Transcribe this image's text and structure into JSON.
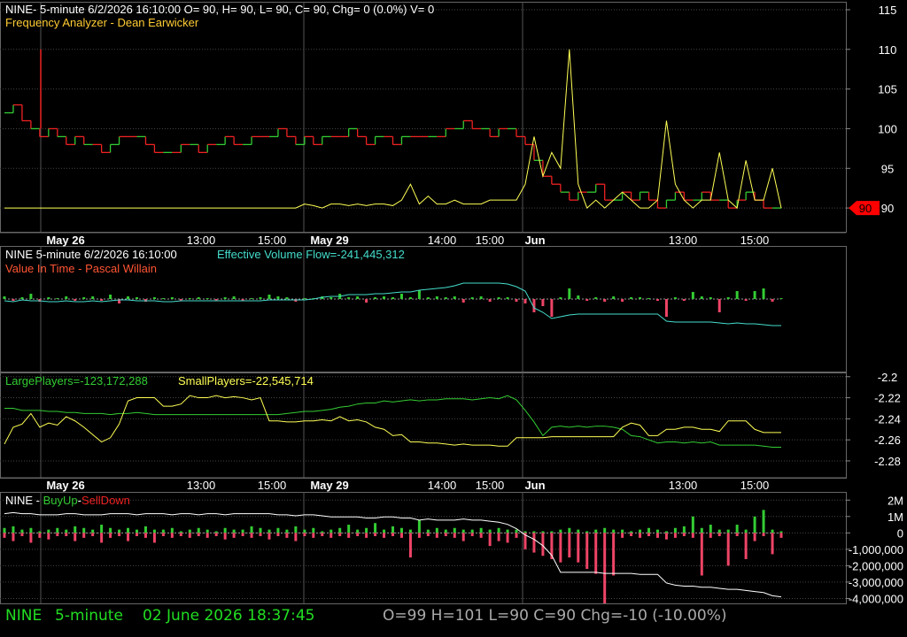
{
  "colors": {
    "bg": "#000000",
    "grid": "#555555",
    "up": "#33cc33",
    "down": "#ee2222",
    "yellow": "#ffff55",
    "cyan": "#44ddcc",
    "green": "#33cc33",
    "white": "#ffffff",
    "orange": "#ffcc33",
    "marker": "#ff0000",
    "axisText": "#ffffff",
    "footGreen": "#22dd22",
    "footGray": "#aaaaaa"
  },
  "panel1": {
    "header": "NINE- 5-minute 6/2/2026 16:10:00 O= 90, H= 90, L= 90, C= 90, Chg= 0 (0.0%) V= 0",
    "subtitle": "Frequency Analyzer - Dean Earwicker",
    "last_price_label": "90"
  },
  "panel2": {
    "header": "NINE 5-minute  6/2/2026 16:10:00",
    "indicator": "Effective Volume Flow=-241,445,312",
    "subtitle": "Value In Time - Pascal Willain"
  },
  "panel3": {
    "large": "LargePlayers=-123,172,288",
    "small": "SmallPlayers=-22,545,714"
  },
  "panel4": {
    "prefix": "NINE - ",
    "buy": "BuyUp",
    "dash": "-",
    "sell": "SellDown"
  },
  "footer": {
    "symbol": "NINE",
    "interval": "5-minute",
    "datetime": "02 June 2026 18:37:45",
    "ohlc": "O=99  H=101  L=90  C=90  Chg=-10 (-10.00%)"
  },
  "chart_data": [
    {
      "type": "line",
      "title": "",
      "y_ticks": [
        90,
        95,
        100,
        105,
        110,
        115
      ],
      "ylim": [
        87,
        116
      ],
      "x_tick_labels": [
        "May 26",
        "13:00",
        "15:00",
        "May 29",
        "14:00",
        "15:00",
        "Jun",
        "13:00",
        "15:00"
      ],
      "series": [
        {
          "name": "",
          "style": "step",
          "values": [
            102,
            103,
            101,
            100,
            99,
            100,
            99,
            98,
            99,
            98,
            98,
            97,
            98,
            99,
            99,
            99,
            98,
            97,
            97,
            97,
            98,
            98,
            97,
            98,
            98,
            99,
            98,
            98,
            99,
            99,
            99,
            100,
            99,
            98,
            99,
            98,
            99,
            99,
            99,
            100,
            99,
            98,
            99,
            99,
            98,
            99,
            99,
            99,
            99,
            99,
            100,
            100,
            101,
            100,
            100,
            99,
            100,
            100,
            99,
            98,
            96,
            94,
            93,
            92,
            91,
            92,
            92,
            93,
            91,
            91,
            92,
            91,
            92,
            91,
            90,
            91,
            92,
            91,
            91,
            92,
            91,
            91,
            90,
            91,
            92,
            91,
            90,
            90,
            90
          ]
        },
        {
          "name": "",
          "style": "line",
          "values": [
            90,
            90,
            90,
            90,
            90,
            90,
            90,
            90,
            90,
            90,
            90,
            90,
            90,
            90,
            90,
            90,
            90,
            90,
            90,
            90,
            90,
            90,
            90,
            90,
            90,
            90,
            90,
            90,
            90,
            90,
            90,
            90,
            90,
            90,
            90.5,
            90.3,
            90,
            90.5,
            90.5,
            90.3,
            90.5,
            90.3,
            90.5,
            90.5,
            90.3,
            91,
            93,
            90.5,
            91.5,
            90.5,
            90.5,
            91,
            90.5,
            90.5,
            90.5,
            91,
            91,
            91,
            91,
            93,
            99,
            94,
            97,
            95,
            110,
            93,
            90,
            91,
            90,
            91,
            92,
            91,
            90,
            90,
            91,
            101,
            93,
            91,
            90,
            91,
            91,
            97,
            91,
            90,
            96,
            91,
            91,
            95,
            90
          ]
        }
      ]
    },
    {
      "type": "bar",
      "title": "",
      "series": [
        {
          "name": "Effective Volume Flow",
          "style": "line",
          "values": [
            -0.2,
            -0.3,
            -0.1,
            -0.2,
            -0.2,
            -0.3,
            -0.3,
            -0.2,
            -0.3,
            -0.3,
            -0.2,
            -0.3,
            -0.2,
            -0.1,
            -0.1,
            -0.2,
            -0.2,
            -0.2,
            -0.3,
            -0.3,
            -0.2,
            -0.2,
            -0.2,
            -0.2,
            -0.2,
            -0.2,
            -0.2,
            -0.2,
            -0.2,
            -0.2,
            -0.1,
            -0.1,
            -0.1,
            -0.1,
            -0.1,
            0,
            0.2,
            0.3,
            0.3,
            0.5,
            0.5,
            0.5,
            0.6,
            0.6,
            0.7,
            0.8,
            0.8,
            1.0,
            1.1,
            1.2,
            1.3,
            1.5,
            1.8,
            1.8,
            1.8,
            1.8,
            1.8,
            1.7,
            1.4,
            0.9,
            -1.0,
            -1.5,
            -2.2,
            -2.0,
            -1.8,
            -1.7,
            -1.7,
            -1.7,
            -1.7,
            -1.7,
            -1.7,
            -1.7,
            -1.7,
            -1.7,
            -1.7,
            -2.5,
            -2.6,
            -2.6,
            -2.6,
            -2.6,
            -2.6,
            -2.7,
            -2.8,
            -2.7,
            -2.8,
            -2.8,
            -2.9,
            -3.0,
            -3.0
          ]
        },
        {
          "name": "",
          "style": "bars",
          "values": [
            0.3,
            -0.2,
            0.2,
            0.6,
            -0.3,
            0.2,
            0.1,
            0.3,
            -0.2,
            0.2,
            0.3,
            -0.2,
            0.5,
            -0.5,
            0.3,
            0.2,
            -0.3,
            0.2,
            0.1,
            0.2,
            -0.2,
            0.1,
            0.2,
            0.1,
            -0.2,
            0.2,
            0.3,
            -0.2,
            0.1,
            0.2,
            0.5,
            0.3,
            0.2,
            -0.3,
            0.1,
            0.1,
            0.3,
            0.2,
            0.6,
            0.2,
            0.3,
            -0.4,
            0.2,
            0.3,
            0.2,
            0.6,
            0.2,
            1.0,
            0.2,
            0.3,
            0.2,
            0.3,
            -0.4,
            0.2,
            0.3,
            -0.3,
            0.2,
            0.2,
            -0.3,
            -0.5,
            -1.5,
            -0.8,
            -2.0,
            0.2,
            1.2,
            0.4,
            -0.2,
            0.2,
            -0.3,
            0.3,
            -0.3,
            0.2,
            0.2,
            0.1,
            -0.2,
            -2.0,
            0.2,
            -0.2,
            0.8,
            0.3,
            0.2,
            -1.5,
            0.2,
            0.9,
            -0.2,
            0.9,
            1.2,
            -0.3,
            0.1
          ]
        }
      ]
    },
    {
      "type": "line",
      "title": "",
      "y_ticks": [
        -2.2,
        -2.22,
        -2.24,
        -2.26,
        -2.28
      ],
      "ylim": [
        -2.296,
        -2.196
      ],
      "series": [
        {
          "name": "LargePlayers",
          "values": [
            -2.23,
            -2.23,
            -2.232,
            -2.232,
            -2.232,
            -2.233,
            -2.233,
            -2.234,
            -2.234,
            -2.235,
            -2.235,
            -2.235,
            -2.236,
            -2.235,
            -2.235,
            -2.234,
            -2.235,
            -2.236,
            -2.236,
            -2.236,
            -2.236,
            -2.236,
            -2.236,
            -2.236,
            -2.236,
            -2.236,
            -2.236,
            -2.236,
            -2.236,
            -2.236,
            -2.236,
            -2.236,
            -2.235,
            -2.234,
            -2.233,
            -2.233,
            -2.232,
            -2.231,
            -2.229,
            -2.228,
            -2.226,
            -2.225,
            -2.225,
            -2.223,
            -2.224,
            -2.223,
            -2.222,
            -2.223,
            -2.222,
            -2.222,
            -2.221,
            -2.221,
            -2.221,
            -2.222,
            -2.221,
            -2.22,
            -2.221,
            -2.218,
            -2.222,
            -2.232,
            -2.243,
            -2.256,
            -2.248,
            -2.247,
            -2.248,
            -2.247,
            -2.248,
            -2.247,
            -2.247,
            -2.248,
            -2.25,
            -2.256,
            -2.257,
            -2.26,
            -2.263,
            -2.262,
            -2.262,
            -2.263,
            -2.262,
            -2.263,
            -2.262,
            -2.265,
            -2.265,
            -2.265,
            -2.265,
            -2.265,
            -2.266,
            -2.267,
            -2.267
          ]
        },
        {
          "name": "SmallPlayers",
          "values": [
            -2.264,
            -2.248,
            -2.245,
            -2.235,
            -2.248,
            -2.244,
            -2.246,
            -2.238,
            -2.242,
            -2.248,
            -2.255,
            -2.262,
            -2.258,
            -2.245,
            -2.223,
            -2.22,
            -2.22,
            -2.22,
            -2.228,
            -2.228,
            -2.226,
            -2.218,
            -2.22,
            -2.22,
            -2.218,
            -2.22,
            -2.219,
            -2.22,
            -2.222,
            -2.22,
            -2.242,
            -2.242,
            -2.243,
            -2.243,
            -2.242,
            -2.242,
            -2.241,
            -2.242,
            -2.238,
            -2.242,
            -2.241,
            -2.243,
            -2.248,
            -2.25,
            -2.256,
            -2.255,
            -2.262,
            -2.262,
            -2.263,
            -2.263,
            -2.264,
            -2.265,
            -2.264,
            -2.265,
            -2.265,
            -2.265,
            -2.266,
            -2.266,
            -2.258,
            -2.258,
            -2.258,
            -2.258,
            -2.257,
            -2.257,
            -2.257,
            -2.257,
            -2.257,
            -2.257,
            -2.257,
            -2.257,
            -2.248,
            -2.244,
            -2.246,
            -2.256,
            -2.256,
            -2.25,
            -2.25,
            -2.248,
            -2.248,
            -2.25,
            -2.25,
            -2.252,
            -2.242,
            -2.242,
            -2.242,
            -2.25,
            -2.253,
            -2.253,
            -2.253
          ]
        }
      ]
    },
    {
      "type": "bar",
      "title": "",
      "y_ticks": [
        "2M",
        "1M",
        "0",
        "-1,000,000",
        "-2,000,000",
        "-3,000,000",
        "-4,000,000"
      ],
      "ylim": [
        -4.3,
        2.5
      ],
      "series": [
        {
          "name": "",
          "style": "line",
          "values": [
            1.8,
            1.9,
            1.8,
            1.8,
            1.7,
            1.7,
            1.7,
            1.8,
            1.8,
            1.7,
            1.7,
            1.7,
            1.8,
            1.8,
            1.8,
            1.7,
            1.8,
            1.8,
            1.8,
            1.7,
            1.8,
            1.8,
            1.7,
            1.8,
            1.8,
            1.7,
            1.8,
            1.8,
            1.8,
            1.8,
            1.8,
            1.7,
            1.7,
            1.6,
            1.7,
            1.7,
            1.6,
            1.5,
            1.5,
            1.5,
            1.5,
            1.4,
            1.4,
            1.5,
            1.5,
            1.4,
            1.4,
            1.2,
            1.3,
            1.2,
            1.2,
            1.2,
            1.3,
            1.2,
            1.2,
            1.1,
            1.0,
            0.8,
            0.4,
            -0.2,
            -0.6,
            -1.2,
            -2.1,
            -3.7,
            -3.7,
            -3.7,
            -3.7,
            -3.7,
            -3.8,
            -3.8,
            -3.8,
            -3.8,
            -3.9,
            -3.9,
            -3.9,
            -4.7,
            -4.9,
            -5.0,
            -5.0,
            -5.1,
            -5.1,
            -5.2,
            -5.3,
            -5.3,
            -5.4,
            -5.5,
            -5.6,
            -5.9,
            -6.0
          ]
        },
        {
          "name": "BuyUp",
          "style": "bars",
          "values": [
            0.3,
            0.4,
            0.2,
            0.3,
            0.1,
            0.2,
            0.3,
            0.2,
            0.4,
            0.3,
            0.2,
            0.5,
            0.3,
            0.2,
            0.3,
            0.2,
            0.4,
            0.2,
            0.2,
            0.3,
            0.1,
            0.2,
            0.3,
            0.2,
            0.1,
            0.3,
            0.2,
            0.2,
            0.4,
            0.3,
            0.2,
            0.3,
            0.2,
            0.4,
            0.2,
            0.3,
            0.1,
            0.2,
            0.3,
            0.5,
            0.2,
            0.3,
            0.6,
            0.2,
            0.4,
            0.3,
            0.2,
            0.8,
            0.2,
            0.3,
            0.2,
            0.3,
            0.2,
            0.2,
            0.3,
            0.2,
            0.3,
            0.2,
            0.2,
            0.1,
            0.1,
            0.1,
            0.1,
            0.2,
            0.3,
            0.2,
            0.1,
            0.2,
            0.3,
            0.2,
            0.2,
            0.1,
            0.2,
            0.3,
            0.2,
            0.1,
            0.3,
            0.4,
            1.0,
            0.3,
            0.5,
            0.2,
            0.2,
            0.5,
            0.2,
            1.0,
            1.4,
            0.2,
            0.1
          ]
        },
        {
          "name": "SellDown",
          "style": "bars",
          "values": [
            -0.3,
            -0.5,
            -0.2,
            -0.6,
            -0.3,
            -0.4,
            -0.2,
            -0.2,
            -0.5,
            -0.3,
            -0.2,
            -0.6,
            -0.3,
            -0.2,
            -0.5,
            -0.2,
            -0.3,
            -0.6,
            -0.2,
            -0.3,
            -0.2,
            -0.3,
            -0.2,
            -0.3,
            -0.2,
            -0.4,
            -0.3,
            -0.2,
            -0.3,
            -0.2,
            -0.4,
            -0.2,
            -0.3,
            -0.5,
            -0.2,
            -0.3,
            -0.2,
            -0.3,
            -0.2,
            -0.3,
            -0.2,
            -0.3,
            -0.2,
            -0.3,
            -0.2,
            -0.3,
            -1.5,
            -0.3,
            -0.2,
            -0.3,
            -0.2,
            -0.3,
            -0.5,
            -0.2,
            -0.3,
            -0.8,
            -0.5,
            -0.6,
            -0.3,
            -1.0,
            -1.2,
            -1.4,
            -1.6,
            -1.8,
            -1.5,
            -1.8,
            -2.2,
            -2.5,
            -4.3,
            -2.6,
            -0.3,
            -0.2,
            -0.3,
            -0.2,
            -0.3,
            -0.4,
            -0.3,
            -0.2,
            -0.3,
            -2.6,
            -0.3,
            -0.2,
            -2.0,
            -0.2,
            -1.6,
            -0.5,
            -0.2,
            -1.3,
            -0.3
          ]
        }
      ]
    }
  ]
}
